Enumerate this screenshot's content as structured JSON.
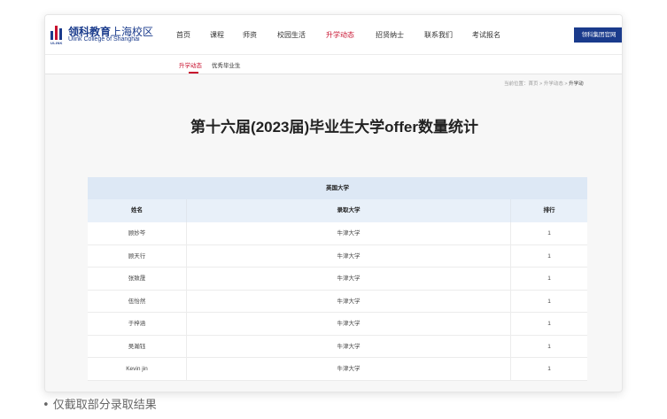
{
  "brand": {
    "name_bold": "领科教育",
    "name_thin": "上海校区",
    "name_en": "Ulink College of Shanghai",
    "mark_text": "ULINK"
  },
  "nav": {
    "items": [
      {
        "label": "首页",
        "active": false
      },
      {
        "label": "课程",
        "active": false
      },
      {
        "label": "师资",
        "active": false
      },
      {
        "label": "校园生活",
        "active": false
      },
      {
        "label": "升学动态",
        "active": true
      },
      {
        "label": "招贤纳士",
        "active": false
      },
      {
        "label": "联系我们",
        "active": false
      },
      {
        "label": "考试报名",
        "active": false
      }
    ],
    "group_button": "领科集团官网"
  },
  "subnav": {
    "items": [
      {
        "label": "升学动态",
        "active": true
      },
      {
        "label": "优秀毕业生",
        "active": false
      }
    ]
  },
  "breadcrumb": {
    "prefix": "当前位置：",
    "home": "首页",
    "sep": " > ",
    "section": "升学动态",
    "current": "升学动"
  },
  "page": {
    "title": "第十六届(2023届)毕业生大学offer数量统计"
  },
  "table": {
    "section": "英国大学",
    "columns": [
      "姓名",
      "录取大学",
      "排行"
    ],
    "rows": [
      {
        "name": "顾妙芩",
        "university": "牛津大学",
        "rank": "1"
      },
      {
        "name": "顾天行",
        "university": "牛津大学",
        "rank": "1"
      },
      {
        "name": "张致晟",
        "university": "牛津大学",
        "rank": "1"
      },
      {
        "name": "伍怡然",
        "university": "牛津大学",
        "rank": "1"
      },
      {
        "name": "于梓涵",
        "university": "牛津大学",
        "rank": "1"
      },
      {
        "name": "吴瀚钰",
        "university": "牛津大学",
        "rank": "1"
      },
      {
        "name": "Kevin jin",
        "university": "牛津大学",
        "rank": "1"
      }
    ]
  },
  "caption": "• 仅截取部分录取结果",
  "colors": {
    "brand_blue": "#1a3b8c",
    "accent_red": "#c8102e",
    "table_header": "#dde8f5"
  }
}
